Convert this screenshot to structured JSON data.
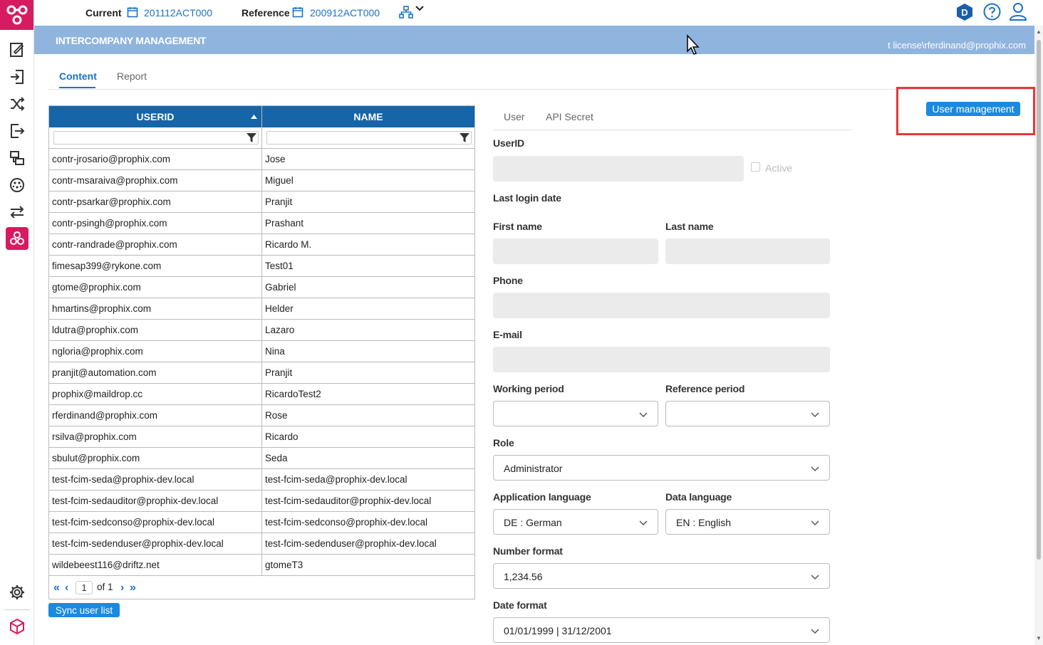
{
  "topbar": {
    "current_label": "Current",
    "current_value": "201112ACT000",
    "reference_label": "Reference",
    "reference_value": "200912ACT000"
  },
  "header": {
    "title": "INTERCOMPANY MANAGEMENT",
    "user": "t license\\rferdinand@prophix.com"
  },
  "tabs": [
    "Content",
    "Report"
  ],
  "grid": {
    "columns": [
      "USERID",
      "NAME"
    ],
    "rows": [
      [
        "contr-jrosario@prophix.com",
        "Jose"
      ],
      [
        "contr-msaraiva@prophix.com",
        "Miguel"
      ],
      [
        "contr-psarkar@prophix.com",
        "Pranjit"
      ],
      [
        "contr-psingh@prophix.com",
        "Prashant"
      ],
      [
        "contr-randrade@prophix.com",
        "Ricardo M."
      ],
      [
        "fimesap399@rykone.com",
        "Test01"
      ],
      [
        "gtome@prophix.com",
        "Gabriel"
      ],
      [
        "hmartins@prophix.com",
        "Helder"
      ],
      [
        "ldutra@prophix.com",
        "Lazaro"
      ],
      [
        "ngloria@prophix.com",
        "Nina"
      ],
      [
        "pranjit@automation.com",
        "Pranjit"
      ],
      [
        "prophix@maildrop.cc",
        "RicardoTest2"
      ],
      [
        "rferdinand@prophix.com",
        "Rose"
      ],
      [
        "rsilva@prophix.com",
        "Ricardo"
      ],
      [
        "sbulut@prophix.com",
        "Seda"
      ],
      [
        "test-fcim-seda@prophix-dev.local",
        "test-fcim-seda@prophix-dev.local"
      ],
      [
        "test-fcim-sedauditor@prophix-dev.local",
        "test-fcim-sedauditor@prophix-dev.local"
      ],
      [
        "test-fcim-sedconso@prophix-dev.local",
        "test-fcim-sedconso@prophix-dev.local"
      ],
      [
        "test-fcim-sedenduser@prophix-dev.local",
        "test-fcim-sedenduser@prophix-dev.local"
      ],
      [
        "wildebeest116@driftz.net",
        "gtomeT3"
      ]
    ],
    "pager": {
      "page": "1",
      "of_text": "of 1"
    }
  },
  "sync_button": "Sync user list",
  "user_management_button": "User management",
  "form": {
    "tabs": [
      "User",
      "API Secret"
    ],
    "userid_label": "UserID",
    "active_label": "Active",
    "last_login_label": "Last login date",
    "first_name_label": "First name",
    "last_name_label": "Last name",
    "phone_label": "Phone",
    "email_label": "E-mail",
    "working_period_label": "Working period",
    "reference_period_label": "Reference period",
    "role_label": "Role",
    "role_value": "Administrator",
    "app_language_label": "Application language",
    "app_language_value": "DE : German",
    "data_language_label": "Data language",
    "data_language_value": "EN : English",
    "number_format_label": "Number format",
    "number_format_value": "1,234.56",
    "date_format_label": "Date format",
    "date_format_value": "01/01/1999 | 31/12/2001"
  },
  "colors": {
    "brand": "#d81b60",
    "header_band": "#8fb4dd",
    "grid_header": "#1565a8",
    "accent": "#1a73c7",
    "button": "#1a8ae0",
    "highlight_frame": "#e53935"
  }
}
